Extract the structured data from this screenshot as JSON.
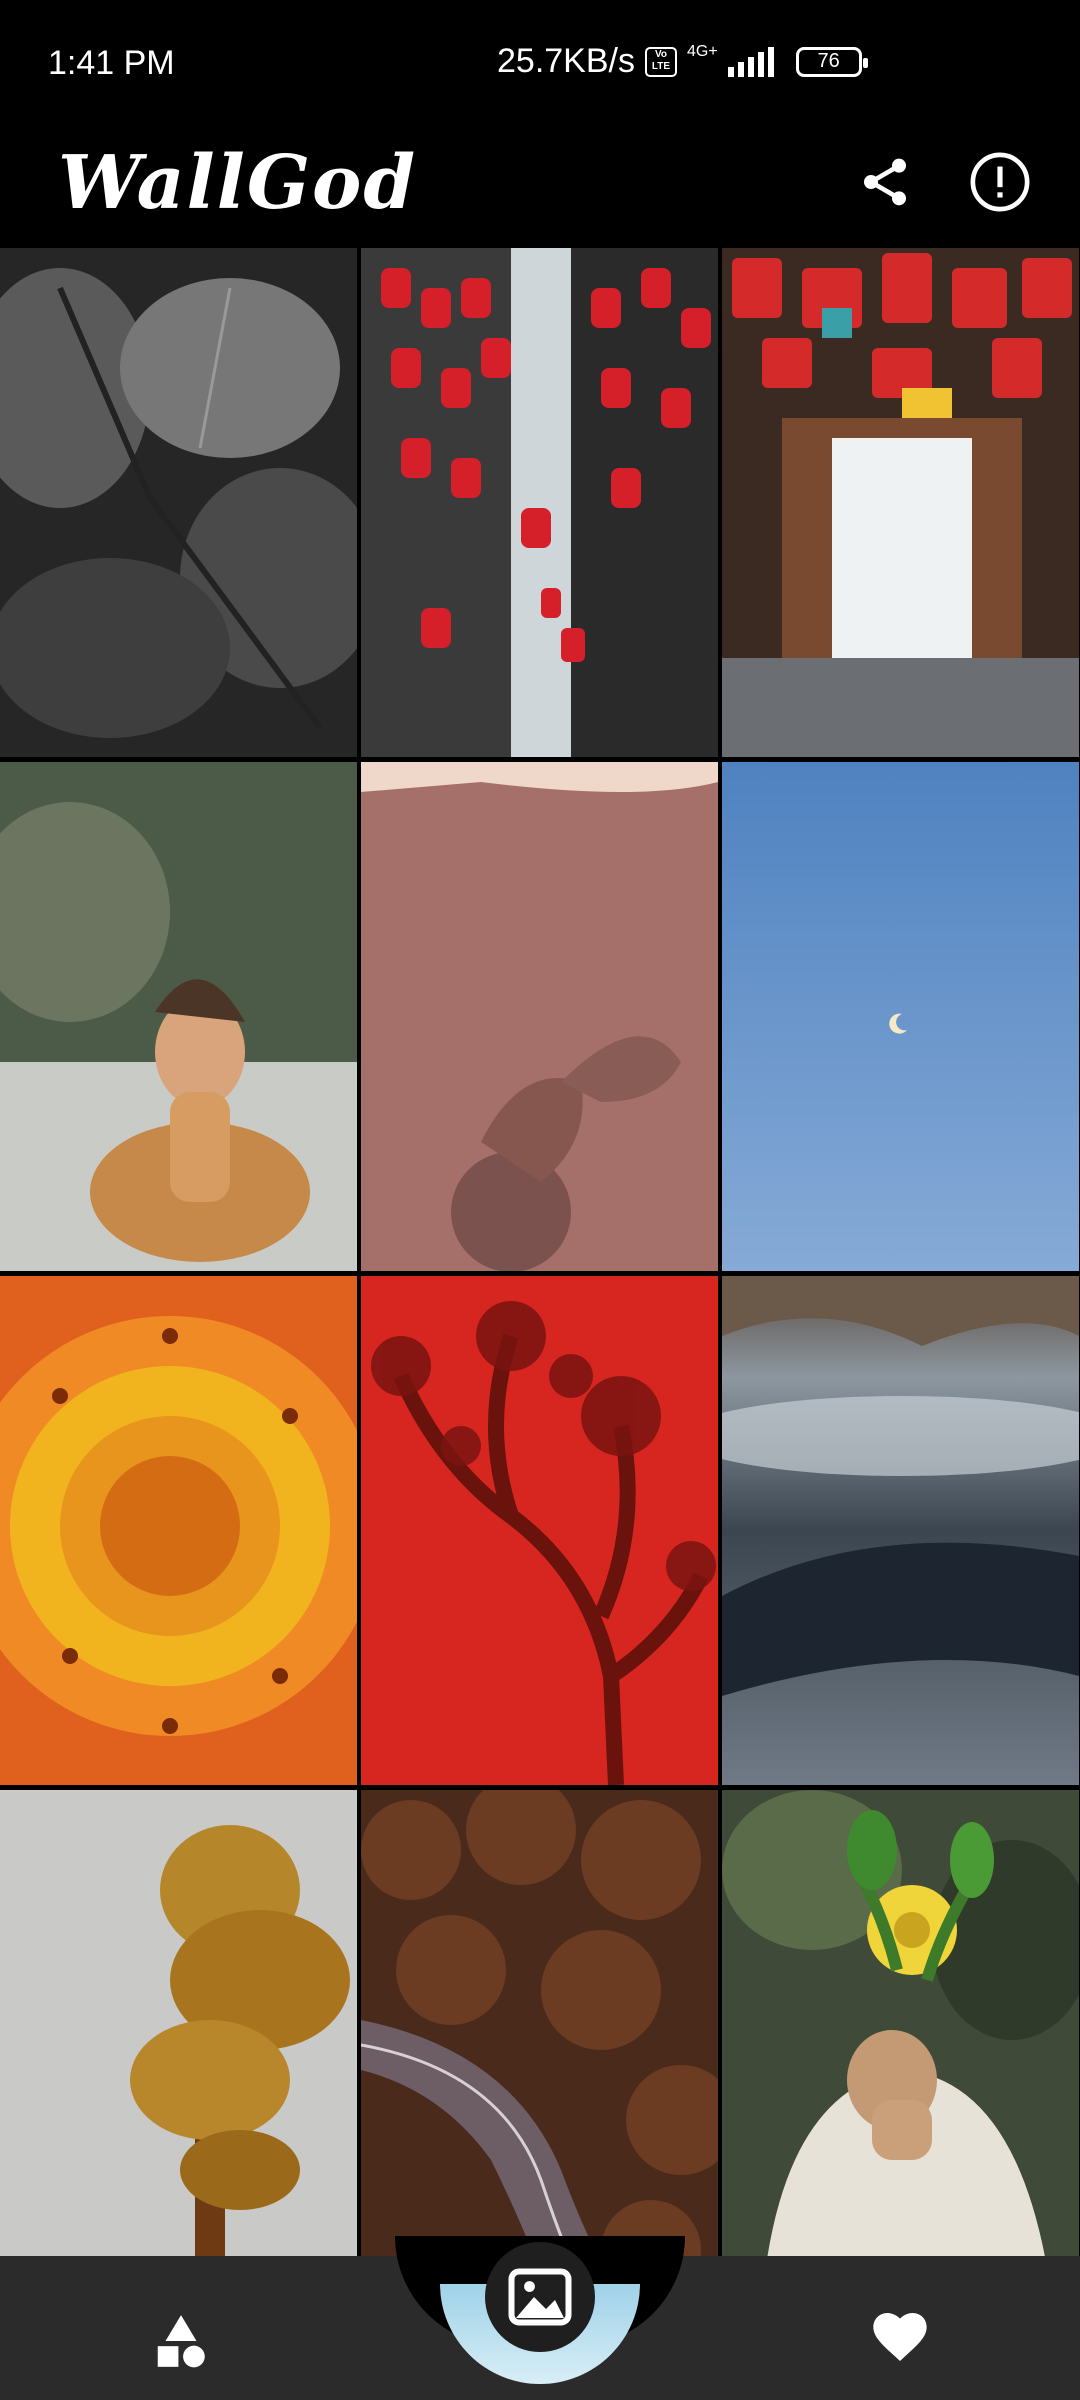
{
  "status_bar": {
    "time": "1:41 PM",
    "net_speed": "25.7KB/s",
    "volte": "Vo LTE",
    "network": "4G+",
    "battery": "76"
  },
  "app_bar": {
    "title": "WallGod",
    "share_icon": "share-icon",
    "info_icon": "info-icon"
  },
  "wallpapers": [
    {
      "subject": "black-and-white leaves"
    },
    {
      "subject": "red lanterns alley"
    },
    {
      "subject": "lantern gate doorway"
    },
    {
      "subject": "woman sitting on beach"
    },
    {
      "subject": "shadow on pink wall"
    },
    {
      "subject": "crescent moon in blue sky"
    },
    {
      "subject": "orange flower closeup"
    },
    {
      "subject": "tree shadow on red wall"
    },
    {
      "subject": "foggy mountains"
    },
    {
      "subject": "autumn tree"
    },
    {
      "subject": "road through forest"
    },
    {
      "subject": "woman holding flowers"
    }
  ],
  "bottom_nav": {
    "items": [
      {
        "icon": "categories-icon"
      },
      {
        "icon": "image-icon",
        "active": true
      },
      {
        "icon": "heart-icon"
      }
    ]
  },
  "colors": {
    "background": "#000000",
    "nav_background": "#2b2b2b",
    "accent_arc": "#9fd2e8"
  }
}
